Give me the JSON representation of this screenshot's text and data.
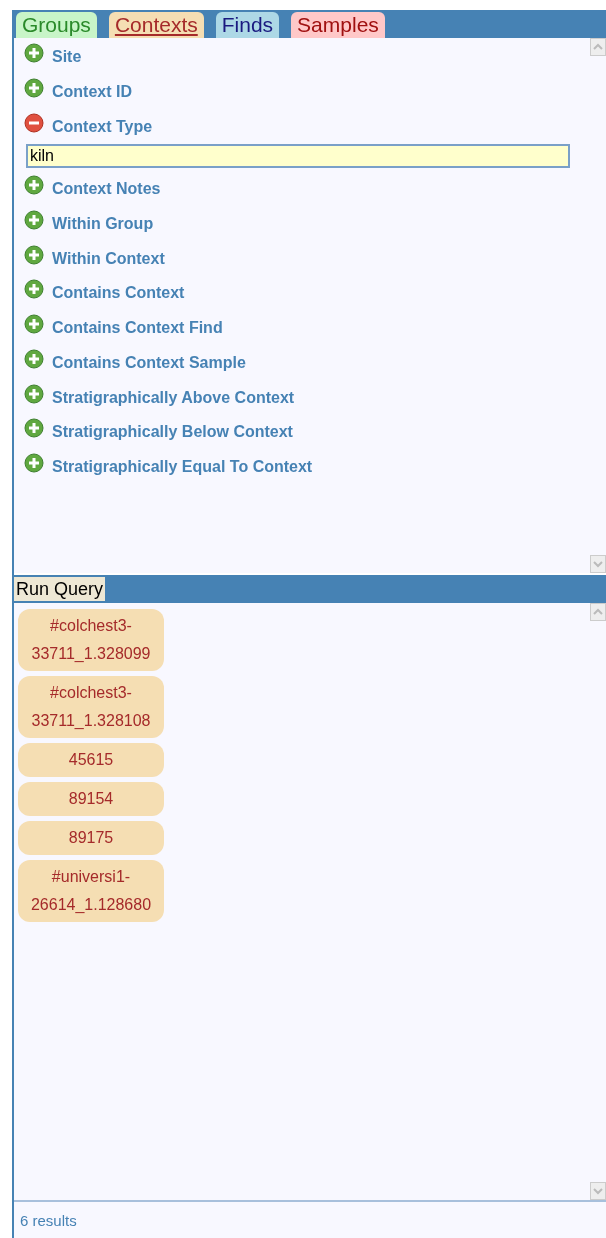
{
  "tabs": [
    {
      "label": "Groups",
      "selected": false,
      "color": "#c8f5c8"
    },
    {
      "label": "Contexts",
      "selected": true,
      "color": "#f5deb3"
    },
    {
      "label": "Finds",
      "selected": false,
      "color": "#add8e6"
    },
    {
      "label": "Samples",
      "selected": false,
      "color": "#ffc8c8"
    }
  ],
  "fields": [
    {
      "label": "Site",
      "expanded": false
    },
    {
      "label": "Context ID",
      "expanded": false
    },
    {
      "label": "Context Type",
      "expanded": true,
      "value": "kiln"
    },
    {
      "label": "Context Notes",
      "expanded": false
    },
    {
      "label": "Within Group",
      "expanded": false
    },
    {
      "label": "Within Context",
      "expanded": false
    },
    {
      "label": "Contains Context",
      "expanded": false
    },
    {
      "label": "Contains Context Find",
      "expanded": false
    },
    {
      "label": "Contains Context Sample",
      "expanded": false
    },
    {
      "label": "Stratigraphically Above Context",
      "expanded": false
    },
    {
      "label": "Stratigraphically Below Context",
      "expanded": false
    },
    {
      "label": "Stratigraphically Equal To Context",
      "expanded": false
    }
  ],
  "run_button": "Run Query",
  "results": [
    "#colchest3-33711_1.328099",
    "#colchest3-33711_1.328108",
    "45615",
    "89154",
    "89175",
    "#universi1-26614_1.128680"
  ],
  "status": "6 results"
}
